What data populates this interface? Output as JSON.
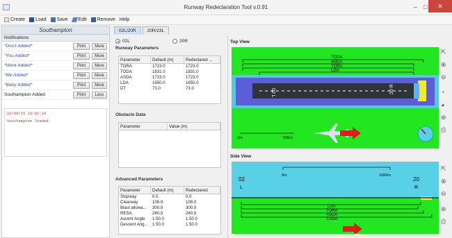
{
  "window": {
    "title": "Runway Redeclaration Tool v.0.91",
    "minimize": "–",
    "maximize": "□",
    "close": "✕"
  },
  "menu": {
    "create": "Create",
    "load": "Load",
    "save": "Save",
    "edit": "Edit",
    "remove": "Remove",
    "help": "Help"
  },
  "sidebar": {
    "airport": "Southampton",
    "header": "Notifications",
    "print_label": "Print",
    "more_label": "More",
    "less_label": "Less",
    "items": [
      {
        "label": "*Don't Added*"
      },
      {
        "label": "*You Added*"
      },
      {
        "label": "*Went Added*"
      },
      {
        "label": "*Me Added*"
      },
      {
        "label": "*Baby Added*"
      },
      {
        "label": "Southampton Added"
      }
    ],
    "log_time": "22/08/15 15:07:24",
    "log_text": "Southampton loaded."
  },
  "tabs": [
    "02L/20R",
    "20R/23L"
  ],
  "radios": {
    "a": "02L",
    "b": "20R"
  },
  "runway_params": {
    "title": "Runway Parameters",
    "headers": [
      "Parameter",
      "Default (m)",
      "Redeclared ..."
    ],
    "rows": [
      [
        "TORA",
        "1723.0",
        "1723.0"
      ],
      [
        "TODA",
        "1831.0",
        "1831.0"
      ],
      [
        "ASDA",
        "1723.0",
        "1723.0"
      ],
      [
        "LDA",
        "1650.0",
        "1650.0"
      ],
      [
        "DT",
        "73.0",
        "73.0"
      ]
    ]
  },
  "obstacle_data": {
    "title": "Obstacle Data",
    "headers": [
      "Parameter",
      "Value (m)"
    ]
  },
  "advanced": {
    "title": "Advanced Parameters",
    "headers": [
      "Parameter",
      "Default (m)",
      "Redeclared"
    ],
    "rows": [
      [
        "Stopway",
        "0.0",
        "0.0"
      ],
      [
        "Clearway",
        "108.0",
        "108.0"
      ],
      [
        "Blast allowa...",
        "300.0",
        "300.0"
      ],
      [
        "RESA",
        "240.0",
        "240.0"
      ],
      [
        "Ascent Angle",
        "1:50.0",
        "1:50.0"
      ],
      [
        "Descent Ang...",
        "1:50.0",
        "1:50.0"
      ]
    ]
  },
  "top_view": {
    "title": "Top View",
    "labels": [
      "TODA",
      "ASDA",
      "TORA",
      "LDA"
    ],
    "runway_left": "02 L",
    "runway_right": "20 R",
    "scale_start": "0m",
    "scale_end": "500m"
  },
  "side_view": {
    "title": "Side View",
    "scale_start": "0m",
    "scale_end": "1000m",
    "left_label": "02",
    "left_sub": "L",
    "right_label": "20",
    "right_sub": "R",
    "labels": [
      "LDA",
      "TORA",
      "ASDA",
      "TODA"
    ]
  },
  "colors": {
    "grass": "#22e61f",
    "clear": "#58d0e6",
    "runway": "#2f3438",
    "arrow": "#e01b1b",
    "tab_active": "#cfe0f4"
  }
}
